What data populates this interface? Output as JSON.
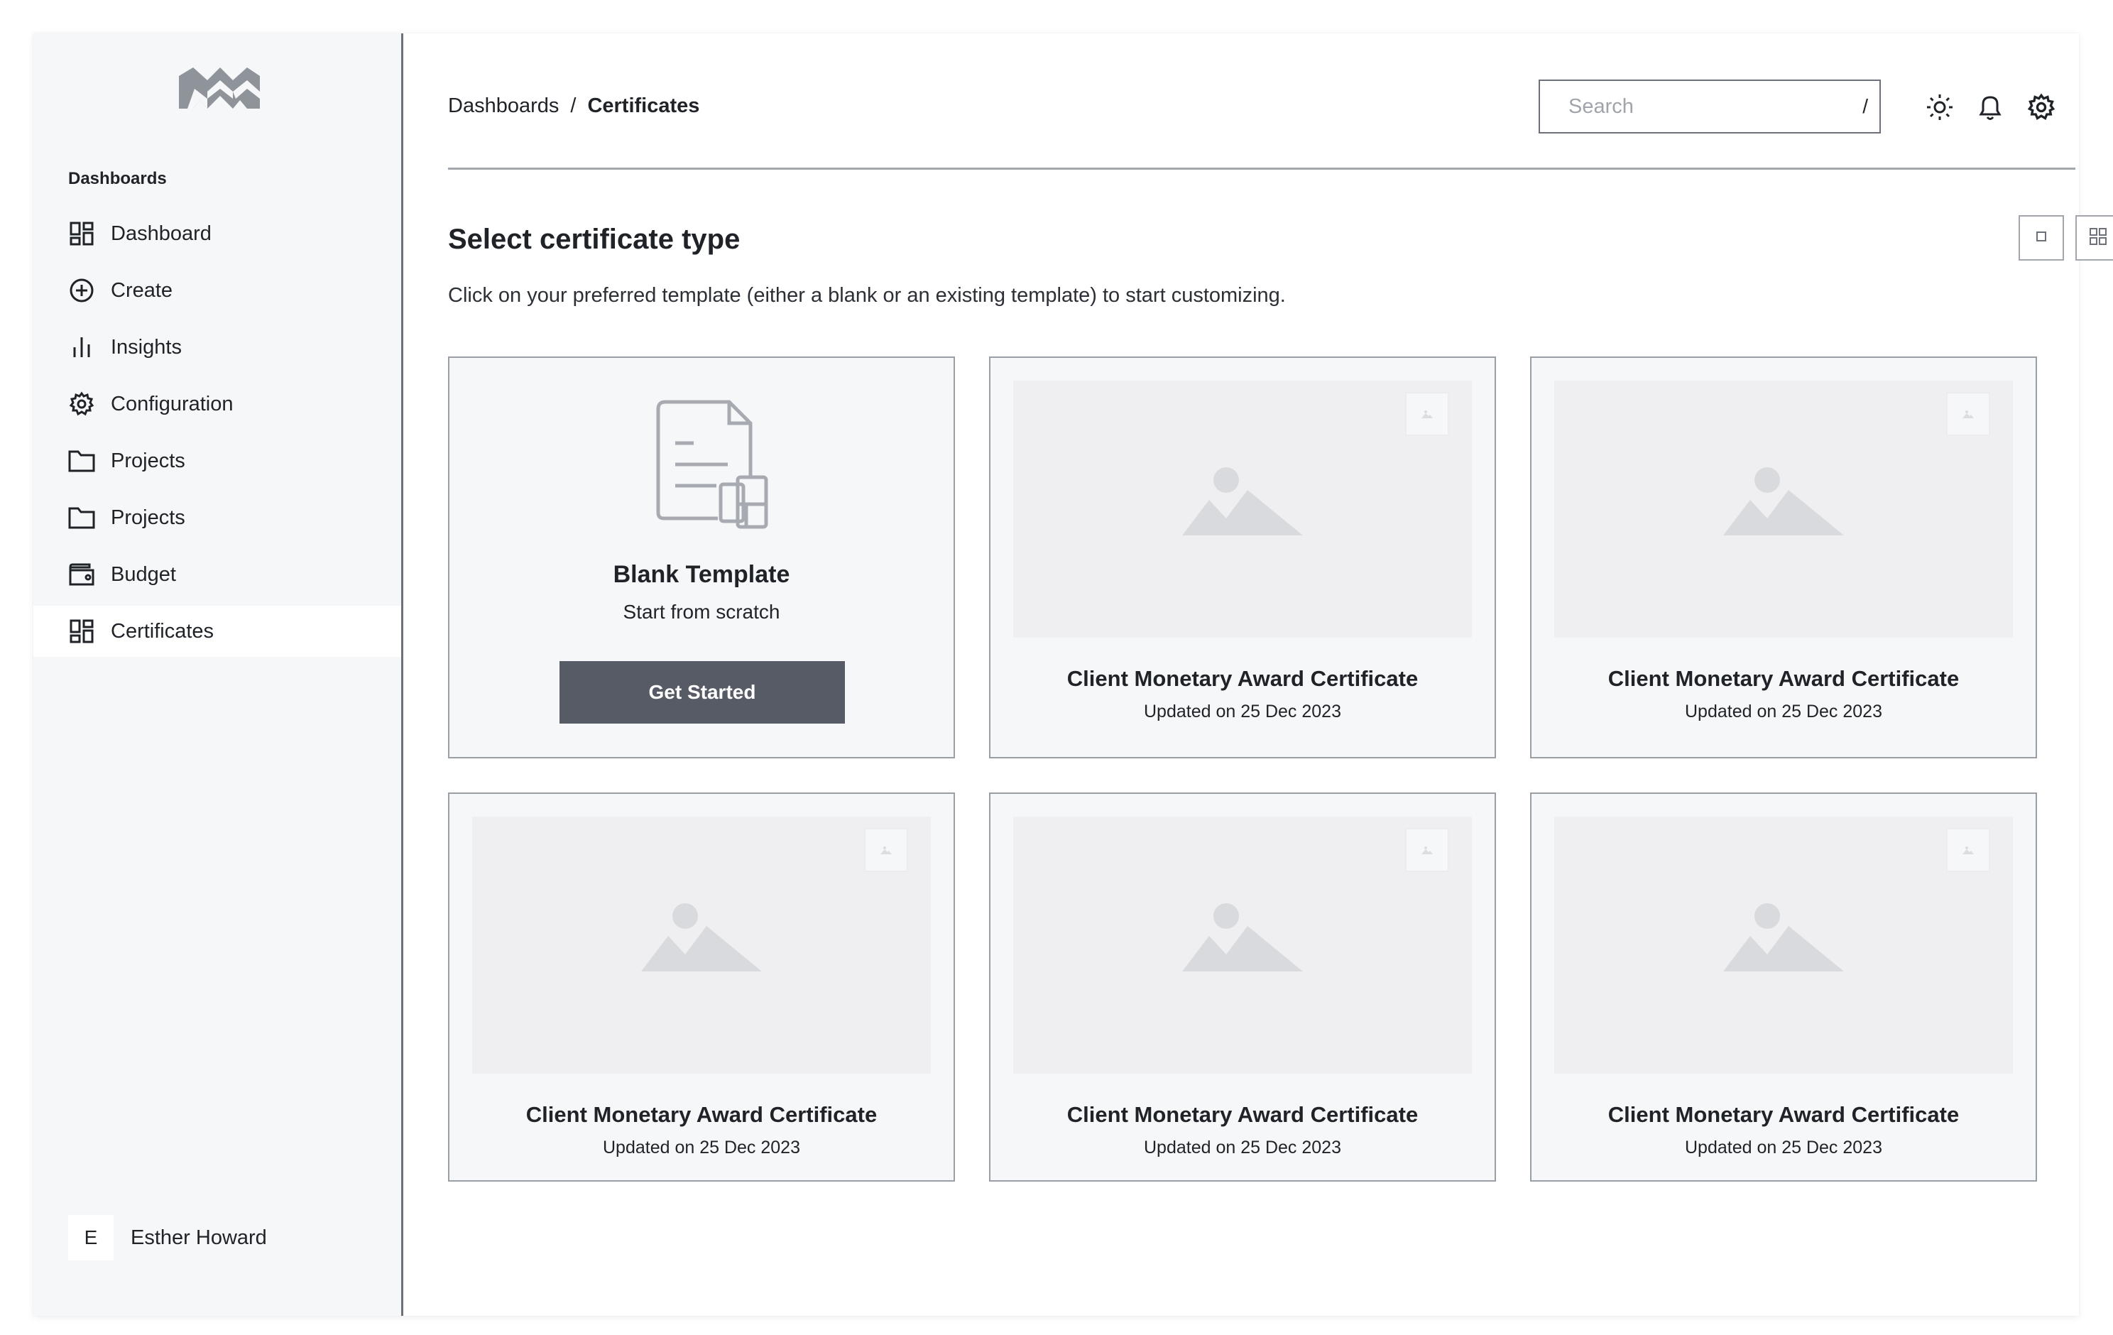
{
  "sidebar": {
    "logo_icon": "brand-logo-icon",
    "section_label": "Dashboards",
    "items": [
      {
        "label": "Dashboard",
        "icon": "grid-icon"
      },
      {
        "label": "Create",
        "icon": "plus-circle-icon"
      },
      {
        "label": "Insights",
        "icon": "bar-chart-icon"
      },
      {
        "label": "Configuration",
        "icon": "gear-icon"
      },
      {
        "label": "Projects",
        "icon": "folder-icon"
      },
      {
        "label": "Projects",
        "icon": "folder-icon"
      },
      {
        "label": "Budget",
        "icon": "wallet-icon"
      },
      {
        "label": "Certificates",
        "icon": "grid-icon",
        "active": true
      }
    ],
    "user": {
      "initial": "E",
      "name": "Esther Howard"
    }
  },
  "header": {
    "breadcrumb": {
      "parent": "Dashboards",
      "separator": "/",
      "current": "Certificates"
    },
    "search": {
      "placeholder": "Search",
      "shortcut": "/"
    },
    "icons": [
      "sun-icon",
      "bell-icon",
      "gear-icon"
    ]
  },
  "main": {
    "title": "Select certificate type",
    "description": "Click on your preferred template (either a blank or an existing template) to start customizing.",
    "view_toggle": [
      "single-view-icon",
      "grid-view-icon"
    ],
    "blank_card": {
      "title": "Blank Template",
      "subtitle": "Start from scratch",
      "button": "Get Started",
      "icon": "document-icon"
    },
    "templates": [
      {
        "title": "Client Monetary Award Certificate",
        "updated": "Updated on 25 Dec 2023"
      },
      {
        "title": "Client Monetary Award Certificate",
        "updated": "Updated on 25 Dec 2023"
      },
      {
        "title": "Client Monetary Award Certificate",
        "updated": "Updated on 25 Dec 2023"
      },
      {
        "title": "Client Monetary Award Certificate",
        "updated": "Updated on 25 Dec 2023"
      },
      {
        "title": "Client Monetary Award Certificate",
        "updated": "Updated on 25 Dec 2023"
      }
    ]
  },
  "colors": {
    "sidebar_bg": "#f6f7f9",
    "card_bg": "#f6f7f9",
    "thumb_bg": "#efeff1",
    "button_bg": "#565b65",
    "text": "#1f2328"
  }
}
